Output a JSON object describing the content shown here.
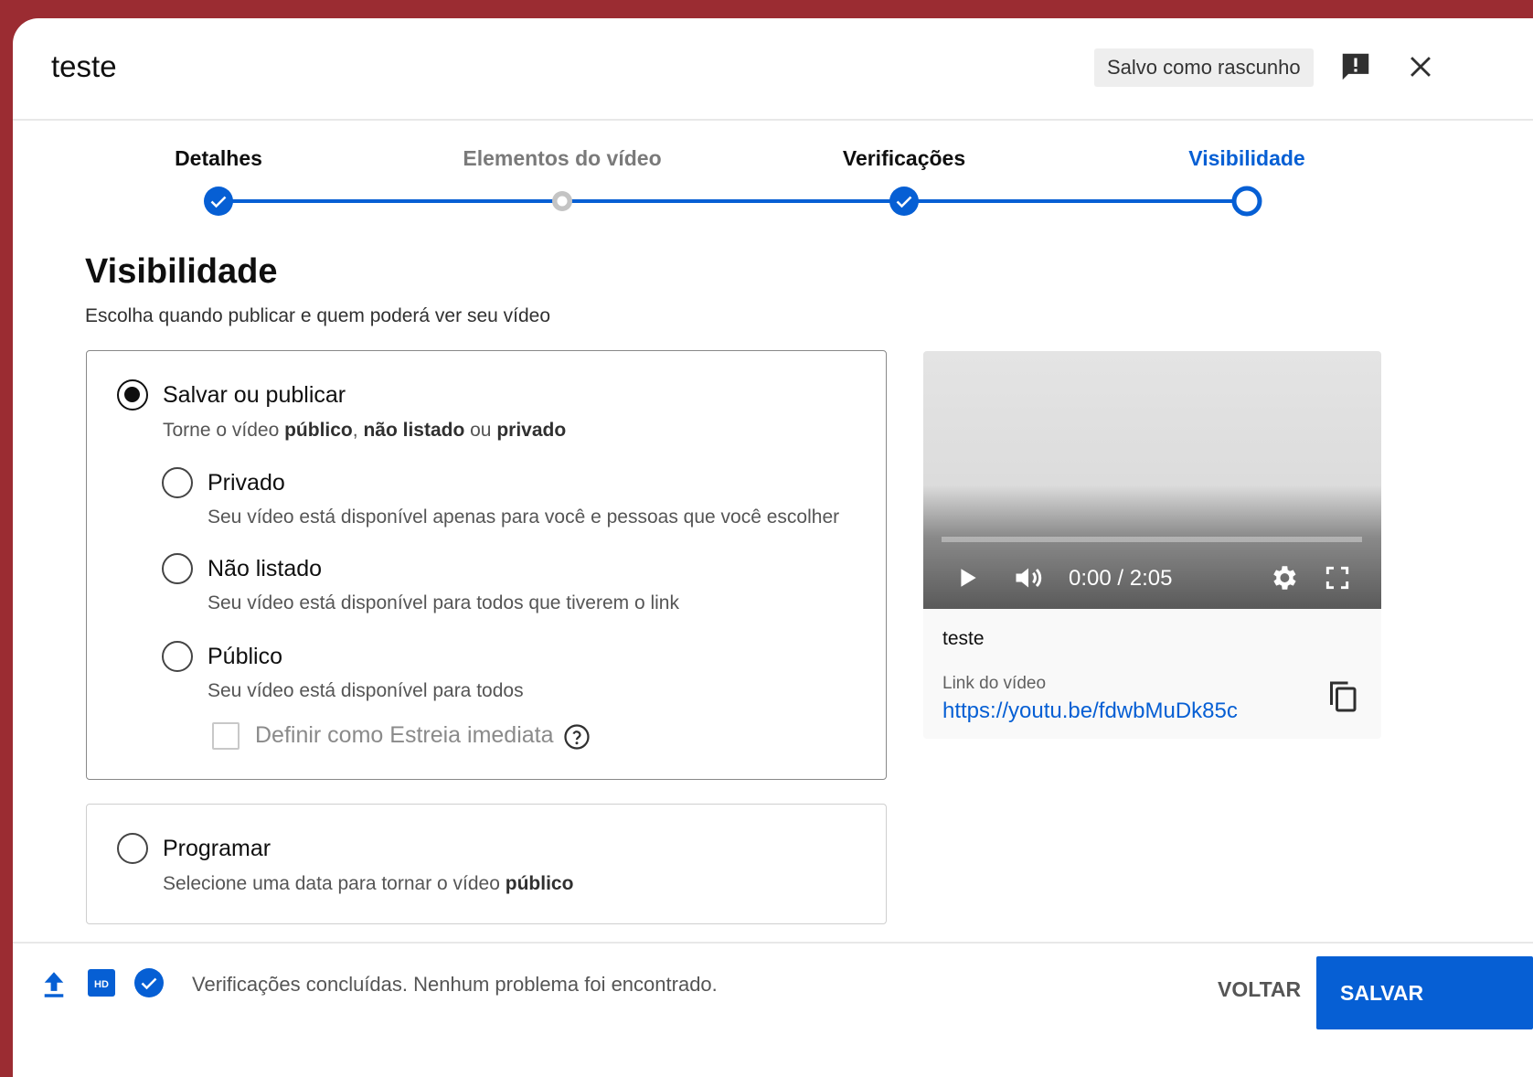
{
  "header": {
    "title": "teste",
    "draft_status": "Salvo como rascunho",
    "feedback_icon": "feedback-icon",
    "close_icon": "close-icon"
  },
  "stepper": {
    "steps": [
      {
        "label": "Detalhes",
        "state": "done"
      },
      {
        "label": "Elementos do vídeo",
        "state": "skipped"
      },
      {
        "label": "Verificações",
        "state": "done"
      },
      {
        "label": "Visibilidade",
        "state": "current"
      }
    ]
  },
  "section": {
    "title": "Visibilidade",
    "subtitle": "Escolha quando publicar e quem poderá ver seu vídeo"
  },
  "save_or_publish": {
    "title": "Salvar ou publicar",
    "desc_prefix": "Torne o vídeo ",
    "desc_public": "público",
    "desc_sep1": ", ",
    "desc_unlisted": "não listado",
    "desc_sep2": " ou ",
    "desc_private": "privado",
    "selected": true,
    "options": [
      {
        "title": "Privado",
        "desc": "Seu vídeo está disponível apenas para você e pessoas que você escolher",
        "selected": false
      },
      {
        "title": "Não listado",
        "desc": "Seu vídeo está disponível para todos que tiverem o link",
        "selected": false
      },
      {
        "title": "Público",
        "desc": "Seu vídeo está disponível para todos",
        "selected": false
      }
    ],
    "premiere_label": "Definir como Estreia imediata",
    "premiere_checked": false
  },
  "schedule": {
    "title": "Programar",
    "desc_prefix": "Selecione uma data para tornar o vídeo ",
    "desc_bold": "público",
    "selected": false
  },
  "video_card": {
    "time": "0:00 / 2:05",
    "name": "teste",
    "link_label": "Link do vídeo",
    "link": "https://youtu.be/fdwbMuDk85c"
  },
  "footer": {
    "status": "Verificações concluídas. Nenhum problema foi encontrado.",
    "back_label": "VOLTAR",
    "save_label": "SALVAR"
  },
  "colors": {
    "accent": "#065fd4",
    "backdrop": "#9b2c32"
  }
}
